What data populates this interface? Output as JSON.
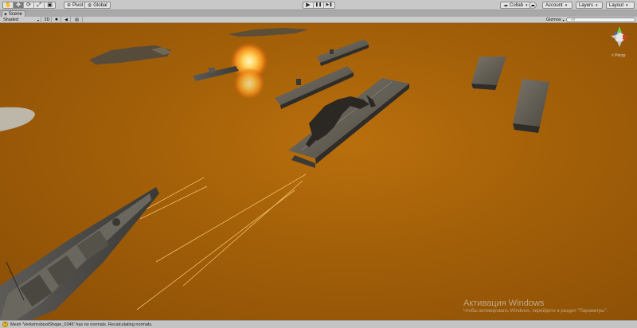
{
  "toolbar": {
    "tools": [
      {
        "icon": "hand-icon",
        "glyph": "✋"
      },
      {
        "icon": "move-icon",
        "glyph": "✥"
      },
      {
        "icon": "rotate-icon",
        "glyph": "⟳"
      },
      {
        "icon": "scale-icon",
        "glyph": "⤢"
      },
      {
        "icon": "rect-icon",
        "glyph": "▣"
      }
    ],
    "pivot_label": "Pivot",
    "global_label": "Global",
    "play_glyph": "▶",
    "pause_glyph": "❚❚",
    "step_glyph": "▶❚",
    "collab_label": "Collab",
    "account_label": "Account",
    "layers_label": "Layers",
    "layout_label": "Layout"
  },
  "scene_tab": {
    "label": "Scene"
  },
  "scene_toolbar": {
    "shading": "Shaded",
    "mode_2d": "2D",
    "gizmos_label": "Gizmos",
    "search_placeholder": "All"
  },
  "viewport": {
    "projection_label": "< Persp",
    "sea_color": "#a25f08"
  },
  "watermark": {
    "title": "Активация Windows",
    "subtitle": "Чтобы активировать Windows, перейдите в раздел \"Параметры\"."
  },
  "status": {
    "message": "Mesh 'VerkehrsbootShape_0345' has no normals. Recalculating normals."
  }
}
